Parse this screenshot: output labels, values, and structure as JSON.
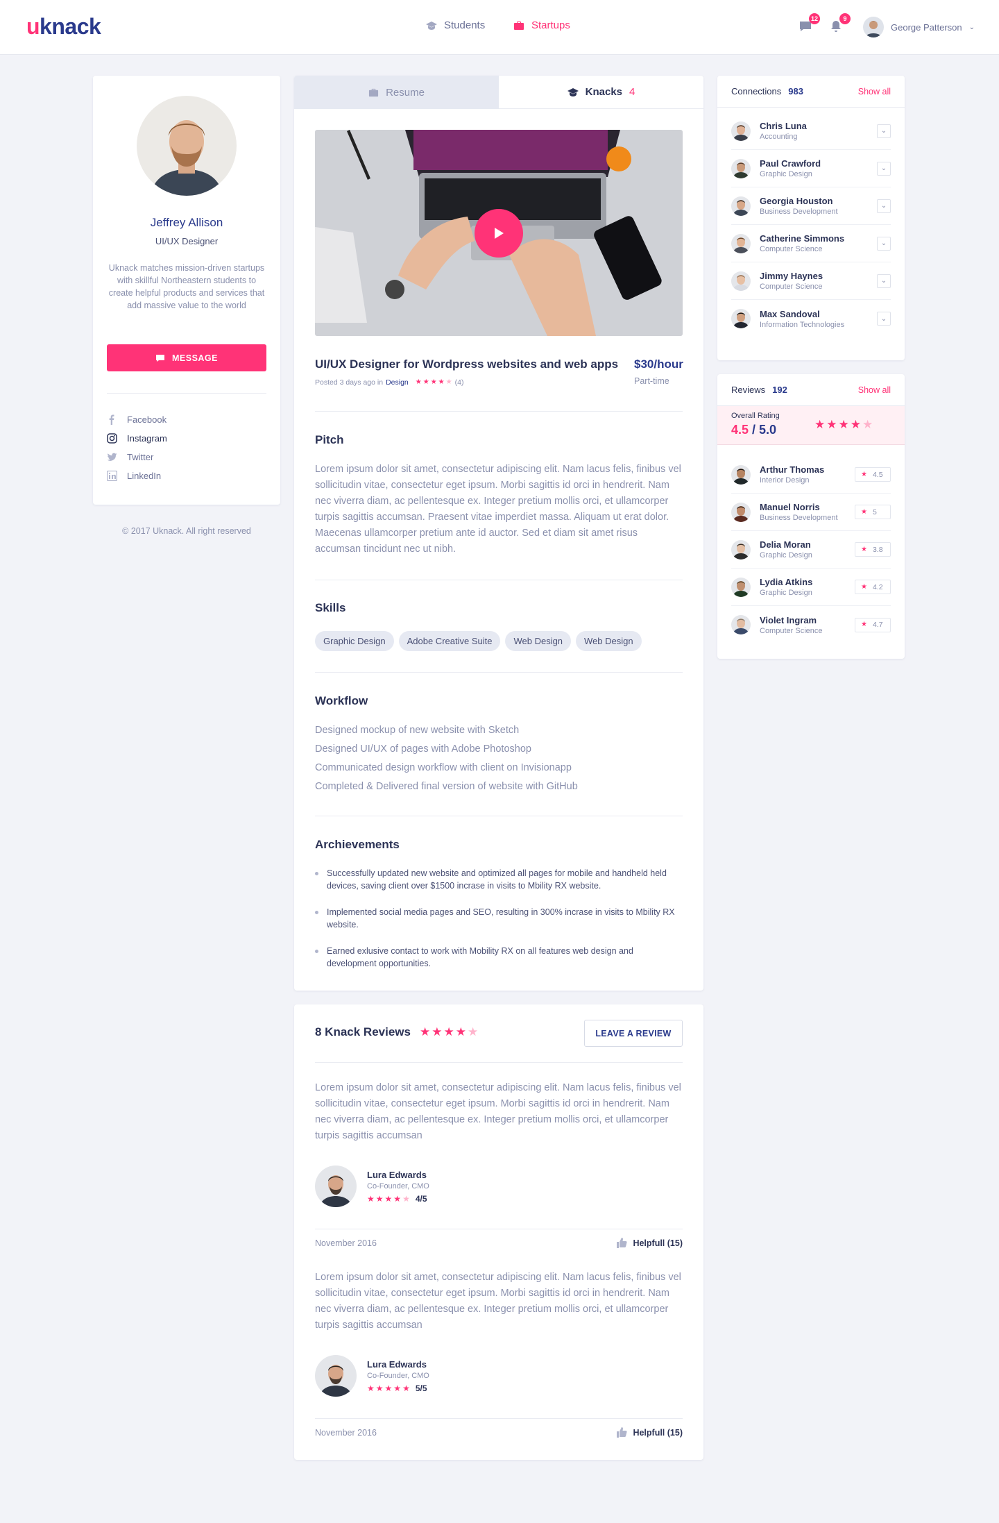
{
  "header": {
    "logo": "knack",
    "nav": [
      {
        "label": "Students"
      },
      {
        "label": "Startups"
      }
    ],
    "messages_count": "12",
    "notifications_count": "9",
    "user_name": "George Patterson"
  },
  "profile": {
    "name": "Jeffrey Allison",
    "title": "UI/UX Designer",
    "description": "Uknack matches mission-driven startups with skillful Northeastern students to create helpful products and services that add massive value to the world",
    "message_label": "MESSAGE",
    "socials": [
      {
        "label": "Facebook"
      },
      {
        "label": "Instagram"
      },
      {
        "label": "Twitter"
      },
      {
        "label": "LinkedIn"
      }
    ],
    "copyright": "© 2017 Uknack. All right reserved"
  },
  "tabs": {
    "resume": "Resume",
    "knacks": "Knacks",
    "knacks_count": "4"
  },
  "knack": {
    "title": "UI/UX Designer for Wordpress websites and web apps",
    "posted": "Posted 3 days ago in",
    "category": "Design",
    "rating_count": "(4)",
    "rating": 4,
    "price": "$30/hour",
    "type": "Part-time"
  },
  "pitch": {
    "title": "Pitch",
    "text": "Lorem ipsum dolor sit amet, consectetur adipiscing elit. Nam lacus felis, finibus vel sollicitudin vitae, consectetur eget ipsum. Morbi sagittis id orci in hendrerit. Nam nec viverra diam, ac pellentesque ex. Integer pretium mollis orci, et ullamcorper turpis sagittis accumsan. Praesent vitae imperdiet massa. Aliquam ut erat dolor. Maecenas ullamcorper pretium ante id auctor. Sed et diam sit amet risus accumsan tincidunt nec ut nibh."
  },
  "skills": {
    "title": "Skills",
    "items": [
      "Graphic Design",
      "Adobe Creative Suite",
      "Web Design",
      "Web Design"
    ]
  },
  "workflow": {
    "title": "Workflow",
    "items": [
      "Designed mockup of new website with Sketch",
      "Designed UI/UX of pages with Adobe Photoshop",
      "Communicated design workflow with client on Invisionapp",
      "Completed & Delivered final version of website with GitHub"
    ]
  },
  "achievements": {
    "title": "Archievements",
    "items": [
      "Successfully updated new website and optimized all pages for mobile and handheld held devices, saving client over $1500 incrase in visits to Mbility RX website.",
      "Implemented social media pages and SEO, resulting in 300% incrase in visits to Mbility RX website.",
      "Earned exlusive contact to work with Mobility RX on all features web design and development opportunities."
    ]
  },
  "knack_reviews": {
    "title": "8 Knack Reviews",
    "rating": 4,
    "leave_label": "LEAVE A REVIEW",
    "items": [
      {
        "text": "Lorem ipsum dolor sit amet, consectetur adipiscing elit. Nam lacus felis, finibus vel sollicitudin vitae, consectetur eget ipsum. Morbi sagittis id orci in hendrerit. Nam nec viverra diam, ac pellentesque ex. Integer pretium mollis orci, et ullamcorper turpis sagittis accumsan",
        "name": "Lura Edwards",
        "role": "Co-Founder, CMO",
        "score": "4/5",
        "rating": 4,
        "date": "November 2016",
        "helpful": "Helpfull (15)"
      },
      {
        "text": "Lorem ipsum dolor sit amet, consectetur adipiscing elit. Nam lacus felis, finibus vel sollicitudin vitae, consectetur eget ipsum. Morbi sagittis id orci in hendrerit. Nam nec viverra diam, ac pellentesque ex. Integer pretium mollis orci, et ullamcorper turpis sagittis accumsan",
        "name": "Lura Edwards",
        "role": "Co-Founder, CMO",
        "score": "5/5",
        "rating": 5,
        "date": "November 2016",
        "helpful": "Helpfull (15)"
      }
    ]
  },
  "connections": {
    "title": "Connections",
    "count": "983",
    "show_all": "Show all",
    "items": [
      {
        "name": "Chris Luna",
        "role": "Accounting"
      },
      {
        "name": "Paul Crawford",
        "role": "Graphic Design"
      },
      {
        "name": "Georgia Houston",
        "role": "Business Development"
      },
      {
        "name": "Catherine Simmons",
        "role": "Computer Science"
      },
      {
        "name": "Jimmy Haynes",
        "role": "Computer Science"
      },
      {
        "name": "Max Sandoval",
        "role": "Information Technologies"
      }
    ]
  },
  "reviews": {
    "title": "Reviews",
    "count": "192",
    "show_all": "Show all",
    "overall_label": "Overall Rating",
    "overall_score": "4.5",
    "overall_max": "/ 5.0",
    "overall_rating": 4.5,
    "items": [
      {
        "name": "Arthur Thomas",
        "role": "Interior Design",
        "score": "4.5"
      },
      {
        "name": "Manuel Norris",
        "role": "Business Development",
        "score": "5"
      },
      {
        "name": "Delia Moran",
        "role": "Graphic Design",
        "score": "3.8"
      },
      {
        "name": "Lydia Atkins",
        "role": "Graphic Design",
        "score": "4.2"
      },
      {
        "name": "Violet Ingram",
        "role": "Computer Science",
        "score": "4.7"
      }
    ]
  },
  "colors": {
    "accent": "#ff3377",
    "brand": "#2a3a8c",
    "background": "#f2f3f8"
  },
  "icons": [
    "chat-icon",
    "bell-icon",
    "briefcase-icon",
    "graduation-cap-icon",
    "play-icon",
    "thumbs-up-icon",
    "star-icon",
    "chevron-down-icon"
  ]
}
